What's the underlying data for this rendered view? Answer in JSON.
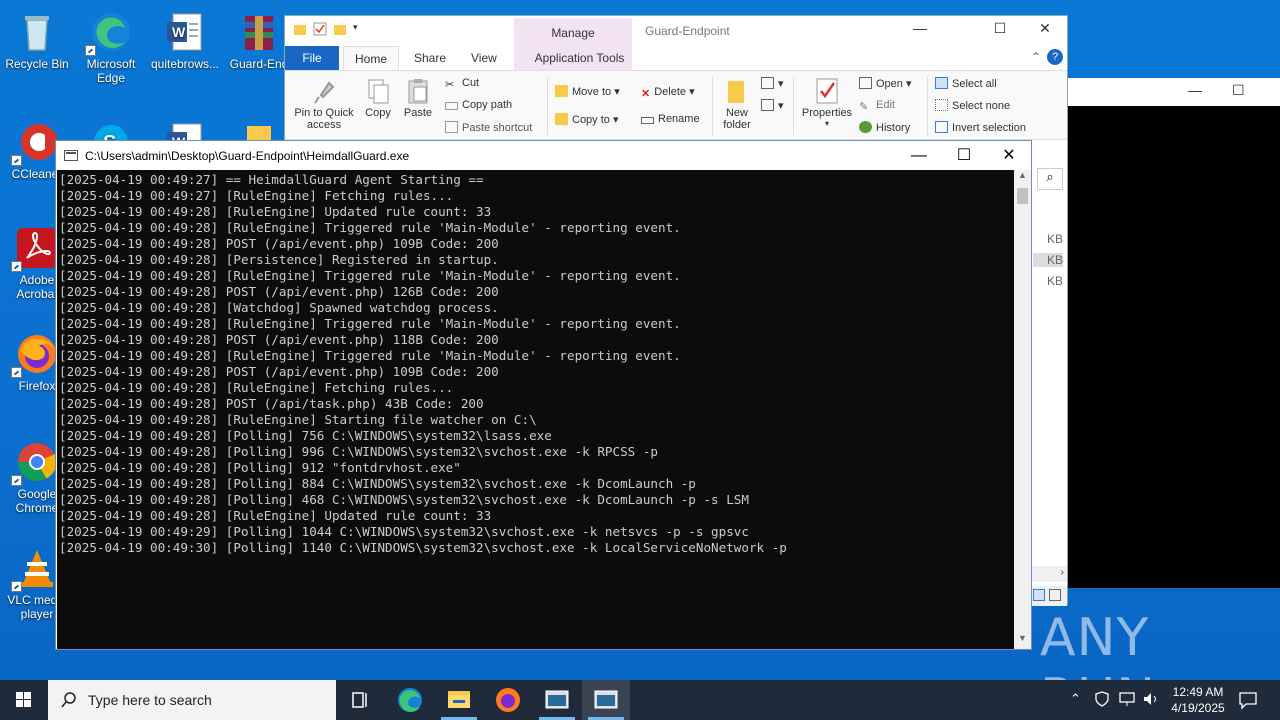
{
  "desktop": {
    "icons": [
      {
        "label": "Recycle Bin"
      },
      {
        "label": "Microsoft Edge"
      },
      {
        "label": "quitebrows..."
      },
      {
        "label": "Guard-End"
      },
      {
        "label": "CCleaner"
      },
      {
        "label": "Adobe Acrobat"
      },
      {
        "label": "Firefox"
      },
      {
        "label": "Google Chrome"
      },
      {
        "label": "VLC media player"
      }
    ]
  },
  "explorer": {
    "title": "Guard-Endpoint",
    "manage_tab": "Manage",
    "tabs": {
      "file": "File",
      "home": "Home",
      "share": "Share",
      "view": "View",
      "app_tools": "Application Tools"
    },
    "ribbon": {
      "pin": "Pin to Quick access",
      "copy": "Copy",
      "paste": "Paste",
      "cut": "Cut",
      "copy_path": "Copy path",
      "paste_shortcut": "Paste shortcut",
      "move_to": "Move to",
      "copy_to": "Copy to",
      "delete": "Delete",
      "rename": "Rename",
      "new_folder": "New folder",
      "properties": "Properties",
      "open": "Open",
      "edit": "Edit",
      "history": "History",
      "select_all": "Select all",
      "select_none": "Select none",
      "invert_selection": "Invert selection"
    },
    "sizes": [
      "KB",
      "KB",
      "KB"
    ]
  },
  "console": {
    "title": "C:\\Users\\admin\\Desktop\\Guard-Endpoint\\HeimdallGuard.exe",
    "lines": [
      "[2025-04-19 00:49:27] == HeimdallGuard Agent Starting ==",
      "[2025-04-19 00:49:27] [RuleEngine] Fetching rules...",
      "[2025-04-19 00:49:28] [RuleEngine] Updated rule count: 33",
      "[2025-04-19 00:49:28] [RuleEngine] Triggered rule 'Main-Module' - reporting event.",
      "[2025-04-19 00:49:28] POST (/api/event.php) 109B Code: 200",
      "[2025-04-19 00:49:28] [Persistence] Registered in startup.",
      "[2025-04-19 00:49:28] [RuleEngine] Triggered rule 'Main-Module' - reporting event.",
      "[2025-04-19 00:49:28] POST (/api/event.php) 126B Code: 200",
      "[2025-04-19 00:49:28] [Watchdog] Spawned watchdog process.",
      "[2025-04-19 00:49:28] [RuleEngine] Triggered rule 'Main-Module' - reporting event.",
      "[2025-04-19 00:49:28] POST (/api/event.php) 118B Code: 200",
      "[2025-04-19 00:49:28] [RuleEngine] Triggered rule 'Main-Module' - reporting event.",
      "[2025-04-19 00:49:28] POST (/api/event.php) 109B Code: 200",
      "[2025-04-19 00:49:28] [RuleEngine] Fetching rules...",
      "[2025-04-19 00:49:28] POST (/api/task.php) 43B Code: 200",
      "[2025-04-19 00:49:28] [RuleEngine] Starting file watcher on C:\\",
      "[2025-04-19 00:49:28] [Polling] 756 C:\\WINDOWS\\system32\\lsass.exe",
      "[2025-04-19 00:49:28] [Polling] 996 C:\\WINDOWS\\system32\\svchost.exe -k RPCSS -p",
      "[2025-04-19 00:49:28] [Polling] 912 \"fontdrvhost.exe\"",
      "[2025-04-19 00:49:28] [Polling] 884 C:\\WINDOWS\\system32\\svchost.exe -k DcomLaunch -p",
      "[2025-04-19 00:49:28] [Polling] 468 C:\\WINDOWS\\system32\\svchost.exe -k DcomLaunch -p -s LSM",
      "[2025-04-19 00:49:28] [RuleEngine] Updated rule count: 33",
      "[2025-04-19 00:49:29] [Polling] 1044 C:\\WINDOWS\\system32\\svchost.exe -k netsvcs -p -s gpsvc",
      "[2025-04-19 00:49:30] [Polling] 1140 C:\\WINDOWS\\system32\\svchost.exe -k LocalServiceNoNetwork -p"
    ]
  },
  "watermark": "ANY RUN",
  "taskbar": {
    "search_placeholder": "Type here to search",
    "time": "12:49 AM",
    "date": "4/19/2025"
  },
  "colors": {
    "desktop": "#0a78d4",
    "taskbar": "#1f2b3a",
    "console_bg": "#0c0c0c",
    "console_fg": "#cccccc",
    "manage_tab": "#f3e2f2"
  }
}
